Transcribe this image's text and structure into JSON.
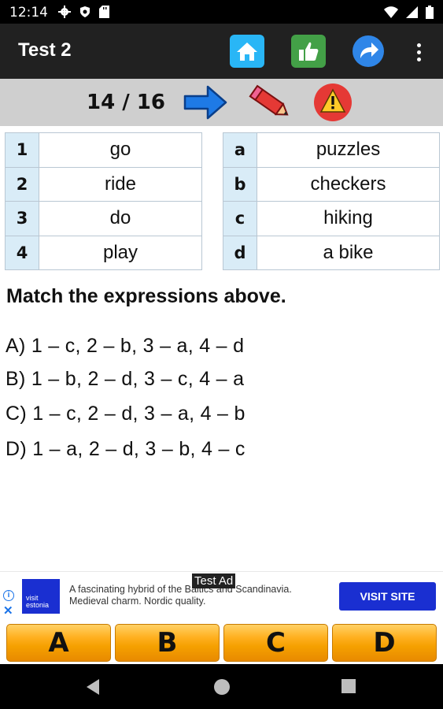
{
  "status_bar": {
    "time": "12:14"
  },
  "app_bar": {
    "title": "Test 2"
  },
  "toolbar": {
    "progress": "14 / 16"
  },
  "left_table": [
    {
      "key": "1",
      "value": "go"
    },
    {
      "key": "2",
      "value": "ride"
    },
    {
      "key": "3",
      "value": "do"
    },
    {
      "key": "4",
      "value": "play"
    }
  ],
  "right_table": [
    {
      "key": "a",
      "value": "puzzles"
    },
    {
      "key": "b",
      "value": "checkers"
    },
    {
      "key": "c",
      "value": "hiking"
    },
    {
      "key": "d",
      "value": "a bike"
    }
  ],
  "question": "Match the expressions above.",
  "options": [
    "A) 1 – c, 2 – b, 3 – a, 4 – d",
    "B) 1 – b, 2 – d, 3 – c, 4 – a",
    "C) 1 – c, 2 – d, 3 – a, 4 – b",
    "D) 1 – a, 2 – d, 3 – b, 4 – c"
  ],
  "ad": {
    "label": "Test Ad",
    "logo_text": "visit estonia",
    "text": "A fascinating hybrid of the Baltics and Scandinavia. Medieval charm. Nordic quality.",
    "cta": "VISIT SITE"
  },
  "answer_buttons": [
    "A",
    "B",
    "C",
    "D"
  ],
  "colors": {
    "app_bar": "#212121",
    "toolbar": "#cfcfcf",
    "table_key_bg": "#d9ecf7",
    "answer_button": "#f5a000",
    "ad_cta": "#1a2fd1"
  },
  "icons": {
    "status": [
      "gear-icon",
      "shield-icon",
      "sd-card-icon",
      "wifi-icon",
      "signal-icon",
      "battery-icon"
    ],
    "app_bar": [
      "home-icon",
      "thumbs-up-icon",
      "share-icon",
      "more-vert-icon"
    ],
    "toolbar": [
      "next-arrow-icon",
      "pencil-icon",
      "warning-icon"
    ],
    "nav": [
      "back-icon",
      "home-circle-icon",
      "recents-icon"
    ]
  }
}
